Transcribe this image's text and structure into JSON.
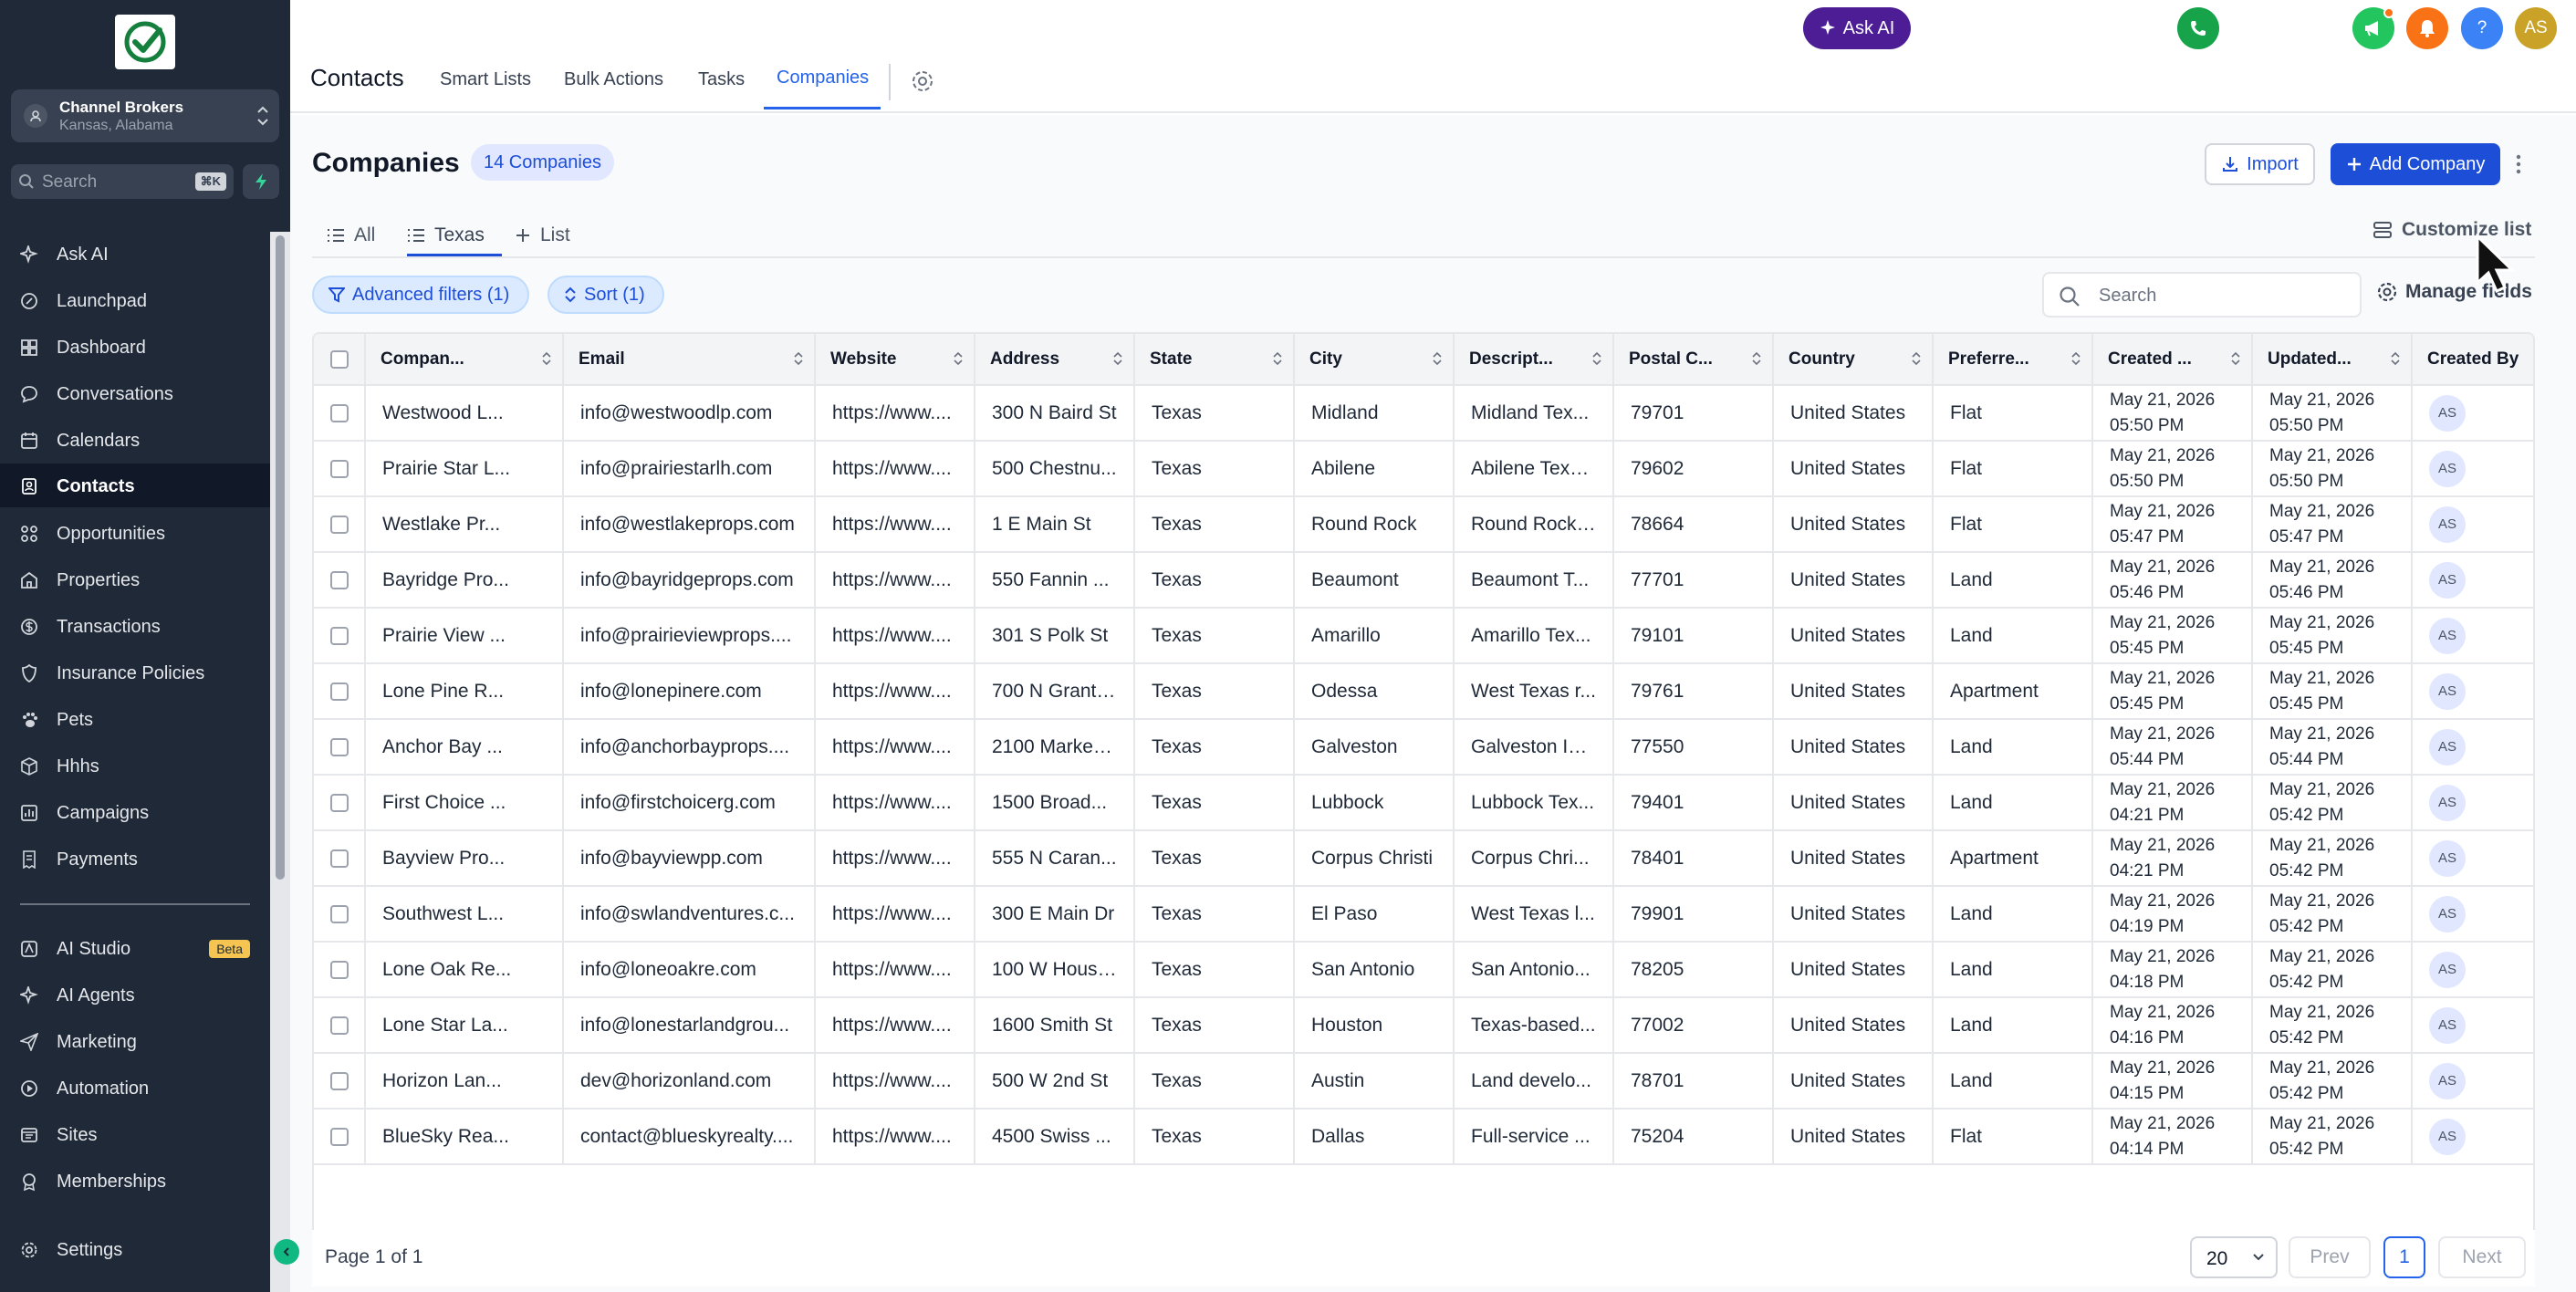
{
  "account": {
    "name": "Channel Brokers",
    "location": "Kansas, Alabama"
  },
  "sidebar": {
    "search_placeholder": "Search",
    "search_shortcut": "⌘K",
    "items": [
      {
        "label": "Ask AI",
        "icon": "sparkle-icon"
      },
      {
        "label": "Launchpad",
        "icon": "rocket-icon"
      },
      {
        "label": "Dashboard",
        "icon": "dashboard-icon"
      },
      {
        "label": "Conversations",
        "icon": "chat-icon"
      },
      {
        "label": "Calendars",
        "icon": "calendar-icon"
      },
      {
        "label": "Contacts",
        "icon": "contacts-icon",
        "active": true
      },
      {
        "label": "Opportunities",
        "icon": "opportunities-icon"
      },
      {
        "label": "Properties",
        "icon": "building-icon"
      },
      {
        "label": "Transactions",
        "icon": "dollar-icon"
      },
      {
        "label": "Insurance Policies",
        "icon": "shield-icon"
      },
      {
        "label": "Pets",
        "icon": "paw-icon"
      },
      {
        "label": "Hhhs",
        "icon": "cube-icon"
      },
      {
        "label": "Campaigns",
        "icon": "campaign-icon"
      },
      {
        "label": "Payments",
        "icon": "receipt-icon"
      },
      {
        "label": "AI Studio",
        "icon": "ai-studio-icon",
        "badge": "Beta"
      },
      {
        "label": "AI Agents",
        "icon": "sparkle-icon"
      },
      {
        "label": "Marketing",
        "icon": "send-icon"
      },
      {
        "label": "Automation",
        "icon": "automation-icon"
      },
      {
        "label": "Sites",
        "icon": "sites-icon"
      },
      {
        "label": "Memberships",
        "icon": "membership-icon"
      },
      {
        "label": "Settings",
        "icon": "gear-icon"
      }
    ]
  },
  "topnav": {
    "title": "Contacts",
    "tabs": [
      "Smart Lists",
      "Bulk Actions",
      "Tasks",
      "Companies"
    ],
    "active_tab": "Companies",
    "ask_ai": "Ask AI",
    "help": "?",
    "user_initials": "AS",
    "colors": {
      "phone": "#16a34a",
      "ask_ai": "#4c1d95",
      "megaphone": "#22c55e",
      "bell": "#f97316",
      "help": "#3b82f6",
      "avatar": "#c9a227"
    }
  },
  "page": {
    "title": "Companies",
    "count_badge": "14 Companies",
    "import_label": "Import",
    "add_label": "Add Company",
    "view_tabs": [
      "All",
      "Texas",
      "List"
    ],
    "active_view": "Texas",
    "customize_label": "Customize list",
    "advanced_filters_label": "Advanced filters (1)",
    "sort_label": "Sort (1)",
    "search_placeholder": "Search",
    "manage_fields_label": "Manage fields"
  },
  "table": {
    "columns": [
      "Compan...",
      "Email",
      "Website",
      "Address",
      "State",
      "City",
      "Descript...",
      "Postal C...",
      "Country",
      "Preferre...",
      "Created ...",
      "Updated...",
      "Created By"
    ],
    "rows": [
      {
        "company": "Westwood L...",
        "email": "info@westwoodlp.com",
        "website": "https://www....",
        "address": "300 N Baird St",
        "state": "Texas",
        "city": "Midland",
        "description": "Midland Tex...",
        "postal": "79701",
        "country": "United States",
        "preferred": "Flat",
        "created_date": "May 21, 2026",
        "created_time": "05:50 PM",
        "updated_date": "May 21, 2026",
        "updated_time": "05:50 PM",
        "created_by": "AS"
      },
      {
        "company": "Prairie Star L...",
        "email": "info@prairiestarlh.com",
        "website": "https://www....",
        "address": "500 Chestnu...",
        "state": "Texas",
        "city": "Abilene",
        "description": "Abilene Texa...",
        "postal": "79602",
        "country": "United States",
        "preferred": "Flat",
        "created_date": "May 21, 2026",
        "created_time": "05:50 PM",
        "updated_date": "May 21, 2026",
        "updated_time": "05:50 PM",
        "created_by": "AS"
      },
      {
        "company": "Westlake Pr...",
        "email": "info@westlakeprops.com",
        "website": "https://www....",
        "address": "1 E Main St",
        "state": "Texas",
        "city": "Round Rock",
        "description": "Round Rock ...",
        "postal": "78664",
        "country": "United States",
        "preferred": "Flat",
        "created_date": "May 21, 2026",
        "created_time": "05:47 PM",
        "updated_date": "May 21, 2026",
        "updated_time": "05:47 PM",
        "created_by": "AS"
      },
      {
        "company": "Bayridge Pro...",
        "email": "info@bayridgeprops.com",
        "website": "https://www....",
        "address": "550 Fannin ...",
        "state": "Texas",
        "city": "Beaumont",
        "description": "Beaumont T...",
        "postal": "77701",
        "country": "United States",
        "preferred": "Land",
        "created_date": "May 21, 2026",
        "created_time": "05:46 PM",
        "updated_date": "May 21, 2026",
        "updated_time": "05:46 PM",
        "created_by": "AS"
      },
      {
        "company": "Prairie View ...",
        "email": "info@prairieviewprops....",
        "website": "https://www....",
        "address": "301 S Polk St",
        "state": "Texas",
        "city": "Amarillo",
        "description": "Amarillo Tex...",
        "postal": "79101",
        "country": "United States",
        "preferred": "Land",
        "created_date": "May 21, 2026",
        "created_time": "05:45 PM",
        "updated_date": "May 21, 2026",
        "updated_time": "05:45 PM",
        "created_by": "AS"
      },
      {
        "company": "Lone Pine R...",
        "email": "info@lonepinere.com",
        "website": "https://www....",
        "address": "700 N Grant ...",
        "state": "Texas",
        "city": "Odessa",
        "description": "West Texas r...",
        "postal": "79761",
        "country": "United States",
        "preferred": "Apartment",
        "created_date": "May 21, 2026",
        "created_time": "05:45 PM",
        "updated_date": "May 21, 2026",
        "updated_time": "05:45 PM",
        "created_by": "AS"
      },
      {
        "company": "Anchor Bay ...",
        "email": "info@anchorbayprops....",
        "website": "https://www....",
        "address": "2100 Market ...",
        "state": "Texas",
        "city": "Galveston",
        "description": "Galveston Isl...",
        "postal": "77550",
        "country": "United States",
        "preferred": "Land",
        "created_date": "May 21, 2026",
        "created_time": "05:44 PM",
        "updated_date": "May 21, 2026",
        "updated_time": "05:44 PM",
        "created_by": "AS"
      },
      {
        "company": "First Choice ...",
        "email": "info@firstchoicerg.com",
        "website": "https://www....",
        "address": "1500 Broad...",
        "state": "Texas",
        "city": "Lubbock",
        "description": "Lubbock Tex...",
        "postal": "79401",
        "country": "United States",
        "preferred": "Land",
        "created_date": "May 21, 2026",
        "created_time": "04:21 PM",
        "updated_date": "May 21, 2026",
        "updated_time": "05:42 PM",
        "created_by": "AS"
      },
      {
        "company": "Bayview Pro...",
        "email": "info@bayviewpp.com",
        "website": "https://www....",
        "address": "555 N Caran...",
        "state": "Texas",
        "city": "Corpus Christi",
        "description": "Corpus Chri...",
        "postal": "78401",
        "country": "United States",
        "preferred": "Apartment",
        "created_date": "May 21, 2026",
        "created_time": "04:21 PM",
        "updated_date": "May 21, 2026",
        "updated_time": "05:42 PM",
        "created_by": "AS"
      },
      {
        "company": "Southwest L...",
        "email": "info@swlandventures.c...",
        "website": "https://www....",
        "address": "300 E Main Dr",
        "state": "Texas",
        "city": "El Paso",
        "description": "West Texas l...",
        "postal": "79901",
        "country": "United States",
        "preferred": "Land",
        "created_date": "May 21, 2026",
        "created_time": "04:19 PM",
        "updated_date": "May 21, 2026",
        "updated_time": "05:42 PM",
        "created_by": "AS"
      },
      {
        "company": "Lone Oak Re...",
        "email": "info@loneoakre.com",
        "website": "https://www....",
        "address": "100 W Houst...",
        "state": "Texas",
        "city": "San Antonio",
        "description": "San Antonio...",
        "postal": "78205",
        "country": "United States",
        "preferred": "Land",
        "created_date": "May 21, 2026",
        "created_time": "04:18 PM",
        "updated_date": "May 21, 2026",
        "updated_time": "05:42 PM",
        "created_by": "AS"
      },
      {
        "company": "Lone Star La...",
        "email": "info@lonestarlandgrou...",
        "website": "https://www....",
        "address": "1600 Smith St",
        "state": "Texas",
        "city": "Houston",
        "description": "Texas-based...",
        "postal": "77002",
        "country": "United States",
        "preferred": "Land",
        "created_date": "May 21, 2026",
        "created_time": "04:16 PM",
        "updated_date": "May 21, 2026",
        "updated_time": "05:42 PM",
        "created_by": "AS"
      },
      {
        "company": "Horizon Lan...",
        "email": "dev@horizonland.com",
        "website": "https://www....",
        "address": "500 W 2nd St",
        "state": "Texas",
        "city": "Austin",
        "description": "Land develo...",
        "postal": "78701",
        "country": "United States",
        "preferred": "Land",
        "created_date": "May 21, 2026",
        "created_time": "04:15 PM",
        "updated_date": "May 21, 2026",
        "updated_time": "05:42 PM",
        "created_by": "AS"
      },
      {
        "company": "BlueSky Rea...",
        "email": "contact@blueskyrealty....",
        "website": "https://www....",
        "address": "4500 Swiss ...",
        "state": "Texas",
        "city": "Dallas",
        "description": "Full-service ...",
        "postal": "75204",
        "country": "United States",
        "preferred": "Flat",
        "created_date": "May 21, 2026",
        "created_time": "04:14 PM",
        "updated_date": "May 21, 2026",
        "updated_time": "05:42 PM",
        "created_by": "AS"
      }
    ]
  },
  "pagination": {
    "page_info": "Page 1 of 1",
    "per_page": "20",
    "prev": "Prev",
    "current": "1",
    "next": "Next"
  }
}
